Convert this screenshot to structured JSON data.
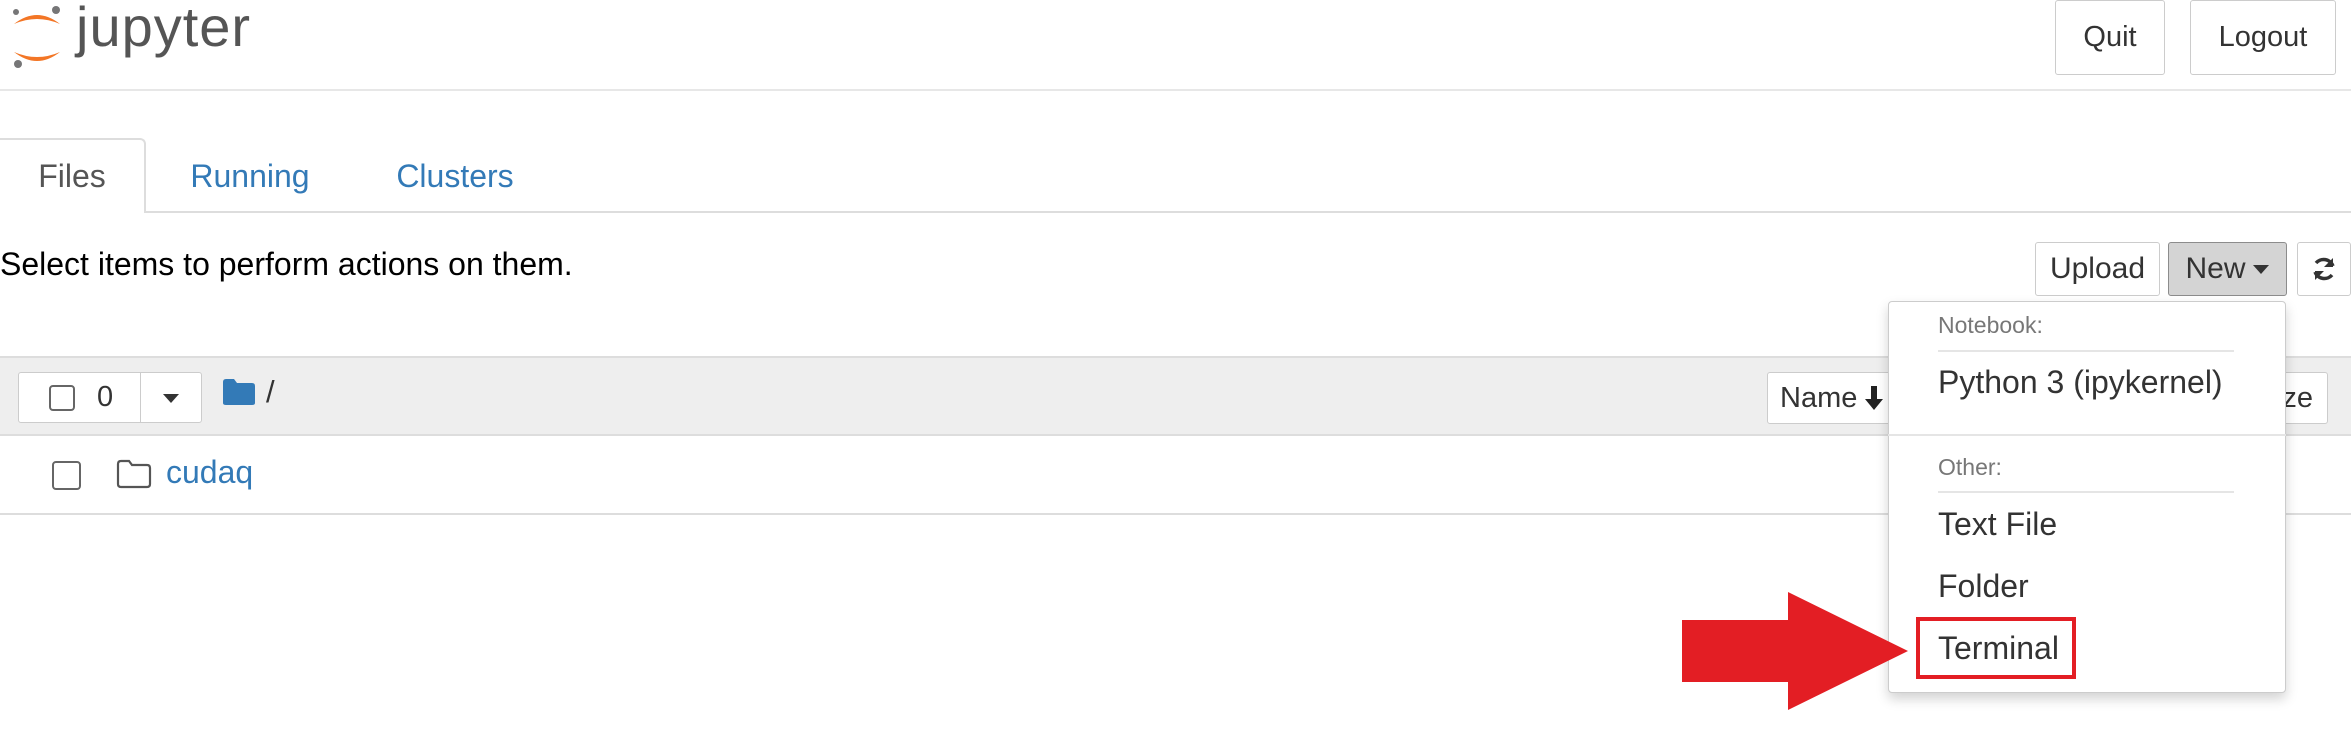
{
  "header": {
    "logo_text": "jupyter",
    "quit_label": "Quit",
    "logout_label": "Logout"
  },
  "tabs": [
    {
      "label": "Files",
      "active": true
    },
    {
      "label": "Running",
      "active": false
    },
    {
      "label": "Clusters",
      "active": false
    }
  ],
  "toolbar": {
    "hint": "Select items to perform actions on them.",
    "upload_label": "Upload",
    "new_label": "New"
  },
  "list": {
    "selected_count": "0",
    "breadcrumb": "/",
    "sort_name_label": "Name",
    "sort_size_label": "ze",
    "rows": [
      {
        "name": "cudaq",
        "type": "folder"
      }
    ]
  },
  "new_menu": {
    "notebook_section": "Notebook:",
    "python_kernel": "Python 3 (ipykernel)",
    "other_section": "Other:",
    "text_file": "Text File",
    "folder": "Folder",
    "terminal": "Terminal"
  },
  "colors": {
    "link": "#337ab7",
    "logo_orange": "#f37626",
    "annotation_red": "#e31e24"
  },
  "icons": [
    "jupyter-logo-icon",
    "caret-down-icon",
    "refresh-icon",
    "folder-solid-icon",
    "folder-outline-icon",
    "sort-arrow-down-icon",
    "red-arrow-icon"
  ]
}
